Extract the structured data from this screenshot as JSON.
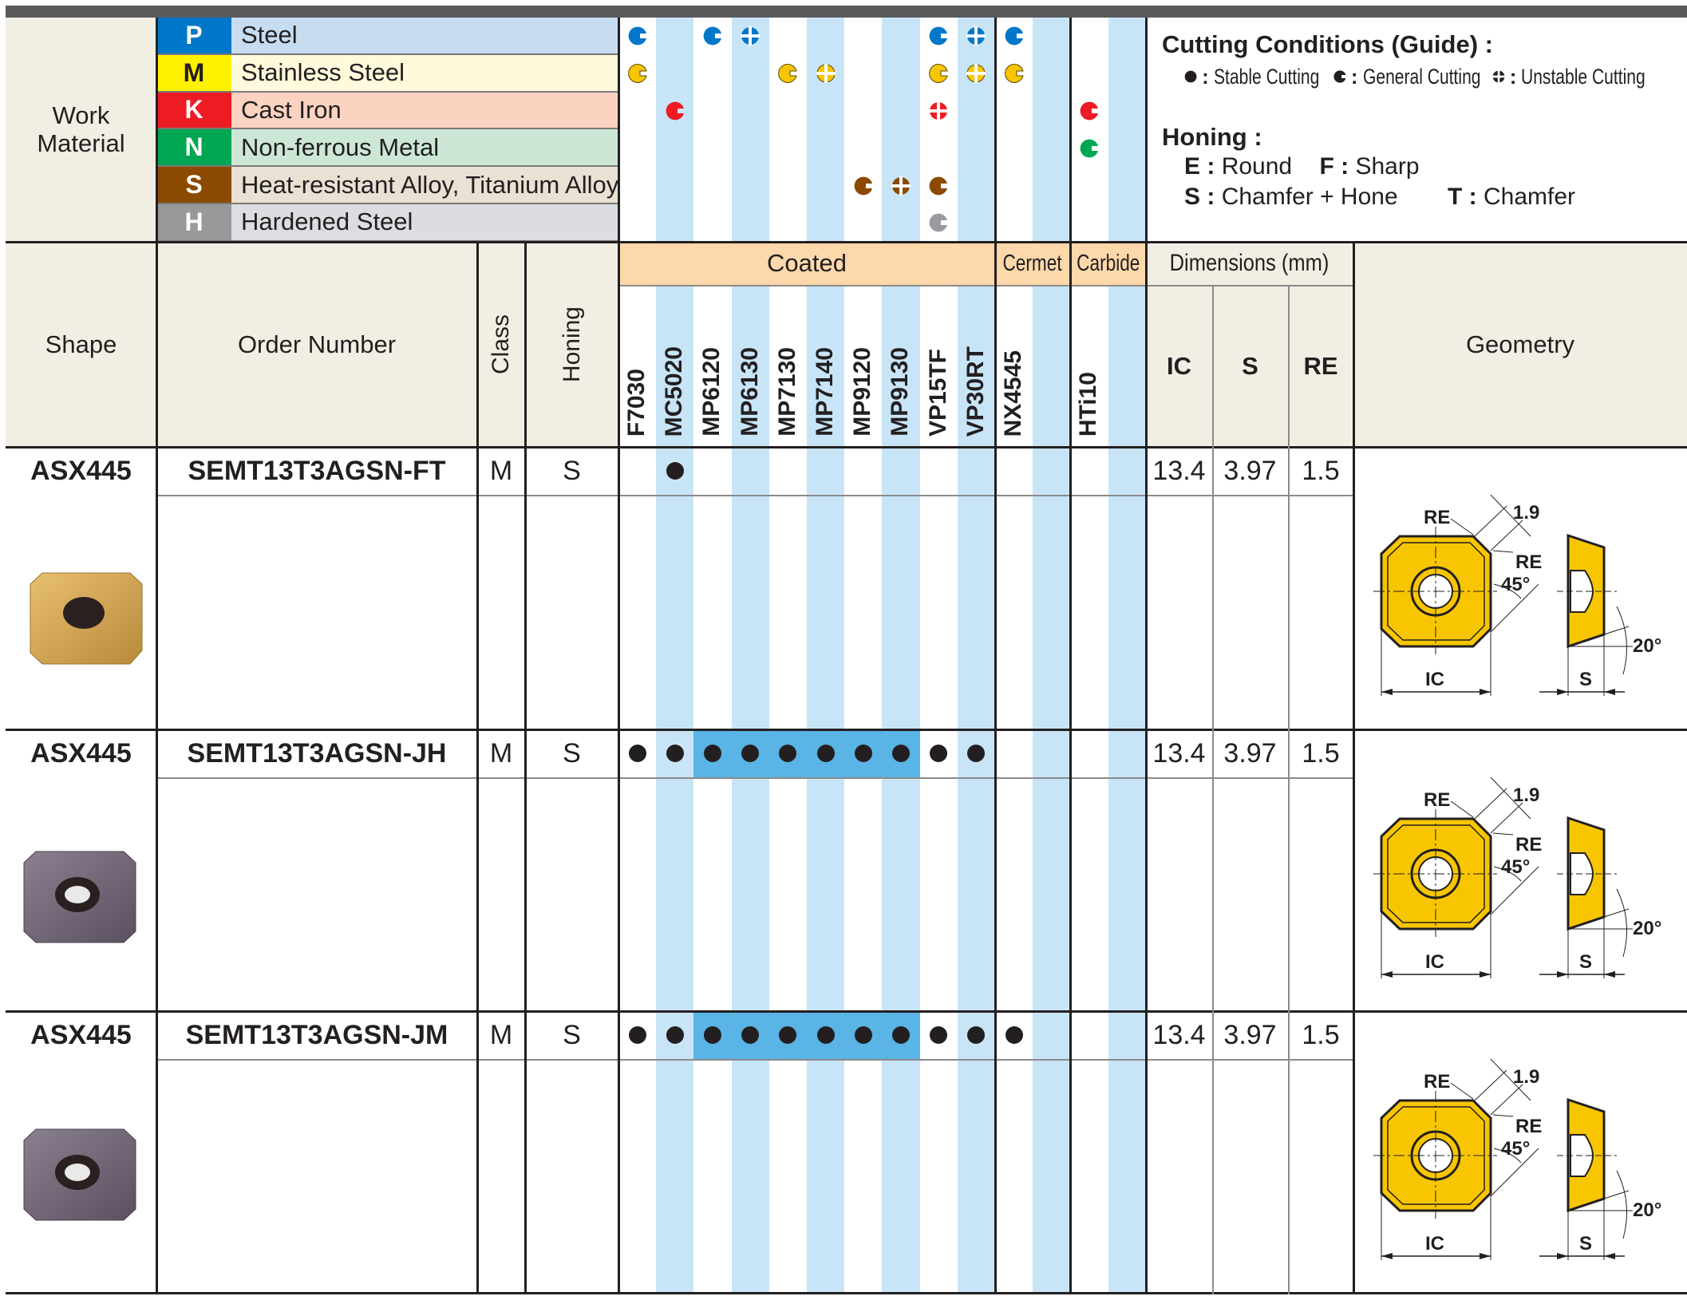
{
  "work_material": {
    "label_line1": "Work",
    "label_line2": "Material",
    "rows": [
      {
        "letter": "P",
        "name": "Steel",
        "color": "#0077c8",
        "bg": "#c6dcf1",
        "letter_color": "#ffffff"
      },
      {
        "letter": "M",
        "name": "Stainless Steel",
        "color": "#fff200",
        "bg": "#fffadb",
        "letter_color": "#231f20"
      },
      {
        "letter": "K",
        "name": "Cast Iron",
        "color": "#ed1c24",
        "bg": "#fcd3c1",
        "letter_color": "#ffffff"
      },
      {
        "letter": "N",
        "name": "Non-ferrous Metal",
        "color": "#00a651",
        "bg": "#cde7d6",
        "letter_color": "#ffffff"
      },
      {
        "letter": "S",
        "name": "Heat-resistant Alloy, Titanium Alloy",
        "color": "#8b4a00",
        "bg": "#e9e1d3",
        "letter_color": "#ffffff"
      },
      {
        "letter": "H",
        "name": "Hardened Steel",
        "color": "#98999b",
        "bg": "#dcdde1",
        "letter_color": "#ffffff"
      }
    ]
  },
  "symbol_colors": {
    "P": "#0077c8",
    "M": "#f7c600",
    "K": "#ed1c24",
    "N": "#00a651",
    "S": "#8b4a00",
    "H": "#9a9b9e"
  },
  "suitability": {
    "P": [
      [
        "0",
        "general"
      ],
      [
        "2",
        "general"
      ],
      [
        "3",
        "unstable"
      ],
      [
        "8",
        "general"
      ],
      [
        "9",
        "unstable"
      ],
      [
        "10",
        "general"
      ]
    ],
    "M": [
      [
        "0",
        "general"
      ],
      [
        "4",
        "general"
      ],
      [
        "5",
        "unstable"
      ],
      [
        "8",
        "general"
      ],
      [
        "9",
        "unstable"
      ],
      [
        "10",
        "general"
      ]
    ],
    "K": [
      [
        "1",
        "general"
      ],
      [
        "8",
        "unstable"
      ],
      [
        "12",
        "general"
      ]
    ],
    "N": [
      [
        "12",
        "general"
      ]
    ],
    "S": [
      [
        "6",
        "general"
      ],
      [
        "7",
        "unstable"
      ],
      [
        "8",
        "general"
      ]
    ],
    "H": [
      [
        "8",
        "general"
      ]
    ]
  },
  "legend": {
    "cutting_title": "Cutting Conditions (Guide) :",
    "stable": "Stable Cutting",
    "general": "General Cutting",
    "unstable": "Unstable Cutting",
    "honing_title": "Honing :",
    "E": "Round",
    "F": "Sharp",
    "S": "Chamfer + Hone",
    "T": "Chamfer"
  },
  "header": {
    "shape": "Shape",
    "order_number": "Order Number",
    "class": "Class",
    "honing": "Honing",
    "coated": "Coated",
    "cermet": "Cermet",
    "carbide": "Carbide",
    "dimensions": "Dimensions (mm)",
    "ic": "IC",
    "s": "S",
    "re": "RE",
    "geometry": "Geometry"
  },
  "grades": [
    "F7030",
    "MC5020",
    "MP6120",
    "MP6130",
    "MP7130",
    "MP7140",
    "MP9120",
    "MP9130",
    "VP15TF",
    "VP30RT",
    "NX4545",
    "",
    "HTi10",
    ""
  ],
  "colors": {
    "stripe": "#c8e5f7",
    "highlight": "#5ab4e5",
    "border": "#231f20",
    "header_bg": "#f1efe4",
    "coated_bg": "#fcd8aa",
    "top_bar": "#58595b"
  },
  "products": [
    {
      "shape": "ASX445",
      "order": "SEMT13T3AGSN-FT",
      "class": "M",
      "honing": "S",
      "stable": [
        1
      ],
      "highlight": false,
      "ic": "13.4",
      "s": "3.97",
      "re": "1.5",
      "chip": "FT",
      "insert_color": "gold"
    },
    {
      "shape": "ASX445",
      "order": "SEMT13T3AGSN-JH",
      "class": "M",
      "honing": "S",
      "stable": [
        0,
        1,
        2,
        3,
        4,
        5,
        6,
        7,
        8,
        9
      ],
      "highlight": true,
      "ic": "13.4",
      "s": "3.97",
      "re": "1.5",
      "chip": "JH",
      "insert_color": "purple"
    },
    {
      "shape": "ASX445",
      "order": "SEMT13T3AGSN-JM",
      "class": "M",
      "honing": "S",
      "stable": [
        0,
        1,
        2,
        3,
        4,
        5,
        6,
        7,
        8,
        9,
        10
      ],
      "highlight": true,
      "ic": "13.4",
      "s": "3.97",
      "re": "1.5",
      "chip": "JM",
      "insert_color": "purple"
    }
  ],
  "geometry_labels": {
    "re": "RE",
    "chamfer": "1.9",
    "angle45": "45°",
    "angle20": "20°",
    "ic": "IC",
    "s": "S"
  }
}
